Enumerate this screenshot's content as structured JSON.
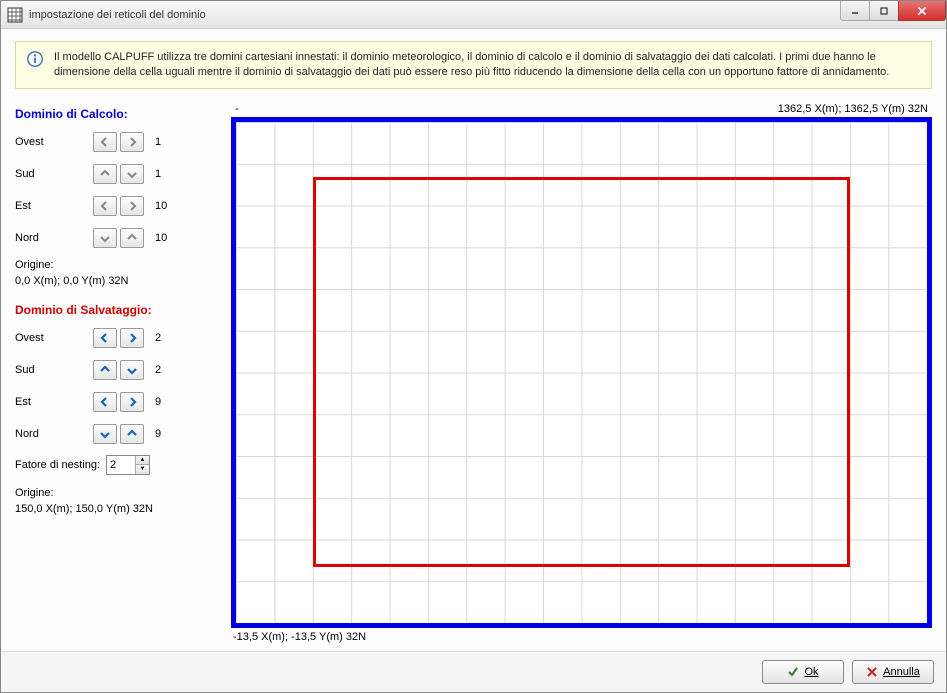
{
  "window": {
    "title": "impostazione dei reticoli del dominio"
  },
  "info": {
    "text": "Il modello CALPUFF utilizza tre domini cartesiani innestati: il dominio meteorologico, il dominio di calcolo e il dominio di salvataggio dei dati calcolati. I primi due hanno le dimensione della cella uguali mentre il dominio di salvataggio dei dati può essere reso più fitto riducendo la dimensione della cella con un opportuno fattore di annidamento."
  },
  "calcolo": {
    "title": "Dominio di Calcolo:",
    "labels": {
      "ovest": "Ovest",
      "sud": "Sud",
      "est": "Est",
      "nord": "Nord"
    },
    "values": {
      "ovest": "1",
      "sud": "1",
      "est": "10",
      "nord": "10"
    },
    "origin_label": "Origine:",
    "origin_value": "0,0 X(m); 0,0 Y(m) 32N"
  },
  "salvataggio": {
    "title": "Dominio di Salvataggio:",
    "labels": {
      "ovest": "Ovest",
      "sud": "Sud",
      "est": "Est",
      "nord": "Nord"
    },
    "values": {
      "ovest": "2",
      "sud": "2",
      "est": "9",
      "nord": "9"
    },
    "nesting_label": "Fatore di nesting:",
    "nesting_value": "2",
    "origin_label": "Origine:",
    "origin_value": "150,0 X(m); 150,0 Y(m) 32N"
  },
  "plot": {
    "top_left": "-",
    "top_right": "1362,5 X(m); 1362,5 Y(m) 32N",
    "bottom_left": "-13,5 X(m); -13,5 Y(m) 32N"
  },
  "buttons": {
    "ok": "Ok",
    "cancel": "Annulla"
  },
  "colors": {
    "calc_domain": "#0000e0",
    "save_domain": "#e00000"
  },
  "chart_data": {
    "type": "area",
    "title": "Domain grid preview",
    "x_range": [
      -13.5,
      1362.5
    ],
    "y_range": [
      -13.5,
      1362.5
    ],
    "units": "m",
    "utm_zone": "32N",
    "outer_domain": {
      "name": "Dominio di Calcolo",
      "x": [
        1,
        10
      ],
      "y": [
        1,
        10
      ],
      "color": "#0000e0"
    },
    "inner_domain": {
      "name": "Dominio di Salvataggio",
      "x": [
        2,
        9
      ],
      "y": [
        2,
        9
      ],
      "color": "#e00000"
    },
    "grid_divisions": {
      "x": 18,
      "y": 12
    }
  }
}
